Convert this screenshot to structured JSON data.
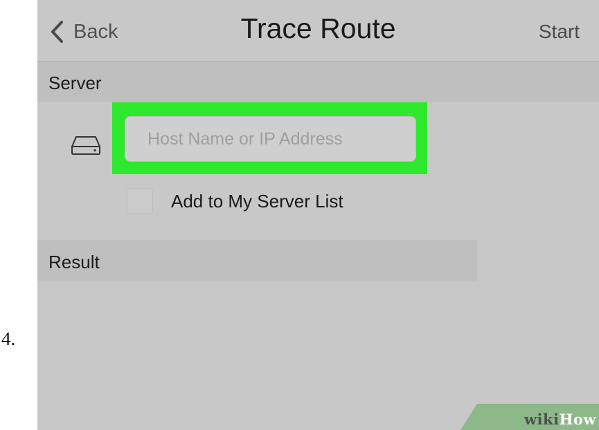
{
  "step": {
    "number": "4."
  },
  "nav": {
    "back_label": "Back",
    "title": "Trace Route",
    "start_label": "Start"
  },
  "server_section": {
    "header": "Server",
    "host_input": {
      "value": "",
      "placeholder": "Host Name or IP Address"
    },
    "add_to_list": {
      "label": "Add to My Server List",
      "checked": false
    }
  },
  "result_section": {
    "header": "Result"
  },
  "highlight": {
    "color": "#2ee82e"
  },
  "watermark": {
    "part1": "wiki",
    "part2": "How"
  },
  "icons": {
    "back": "chevron-left-icon",
    "server": "hard-drive-icon"
  }
}
